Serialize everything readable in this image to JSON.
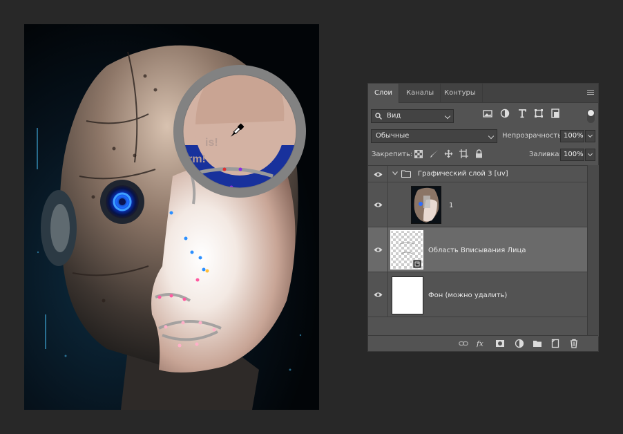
{
  "colors": {
    "panel_bg": "#535353",
    "selected_layer": "#6a6a6a",
    "app_bg": "#282828",
    "loupe_ring": "#808080",
    "loupe_sample_new": "#d3b2a3",
    "loupe_sample_old": "#18319c",
    "eye_glow": "#1a6cff"
  },
  "canvas": {
    "artwork_text_1": "is!",
    "artwork_text_2": "form!"
  },
  "panel": {
    "tabs": [
      "Слои",
      "Каналы",
      "Контуры"
    ],
    "active_tab": "Слои",
    "filter": {
      "label": "Вид"
    },
    "blend_mode": "Обычные",
    "opacity": {
      "label": "Непрозрачность:",
      "value": "100%"
    },
    "lock": {
      "label": "Закрепить:"
    },
    "fill": {
      "label": "Заливка:",
      "value": "100%"
    },
    "layers": [
      {
        "name": "Графический слой 3 [uv]",
        "type": "group",
        "visible": true,
        "expanded": true
      },
      {
        "name": "1",
        "type": "image",
        "visible": true,
        "selected": false
      },
      {
        "name": "Область Вписывания Лица",
        "type": "smart-object",
        "visible": true,
        "selected": true
      },
      {
        "name": "Фон (можно удалить)",
        "type": "background",
        "visible": true,
        "selected": false
      }
    ]
  }
}
